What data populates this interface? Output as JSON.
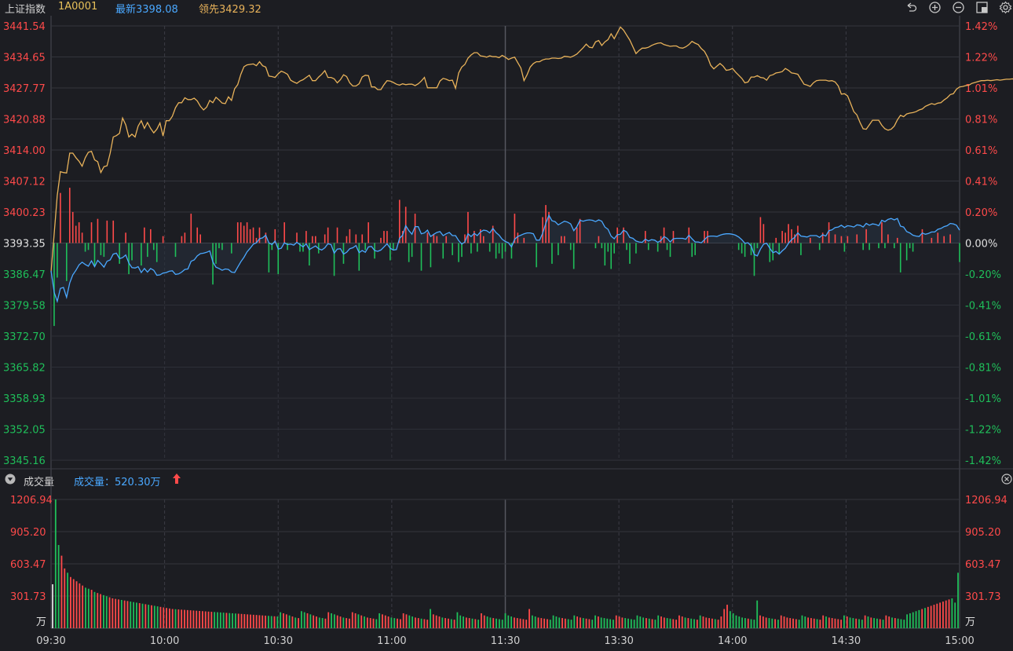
{
  "header": {
    "index_name": "上证指数",
    "index_code": "1A0001",
    "latest_label": "最新3398.08",
    "leading_label": "领先3429.32"
  },
  "toolbar": {
    "icons": [
      "undo-icon",
      "zoom-in-icon",
      "zoom-out-icon",
      "layout-icon",
      "settings-icon"
    ]
  },
  "colors": {
    "background": "#1c1d22",
    "up": "#ff4a4a",
    "down": "#1fbf5a",
    "price_line": "#4aa8ff",
    "leading_line": "#e8b25a",
    "grid": "#33353c"
  },
  "volume_panel": {
    "title": "成交量",
    "volume_label": "成交量：520.30万",
    "unit": "万"
  },
  "chart_data": [
    {
      "type": "line",
      "title": "",
      "x_ticks": [
        "09:30",
        "10:00",
        "10:30",
        "11:00",
        "11:30",
        "13:30",
        "14:00",
        "14:30",
        "15:00"
      ],
      "y_left_ticks": [
        "3441.54",
        "3434.65",
        "3427.77",
        "3420.88",
        "3414.00",
        "3407.12",
        "3400.23",
        "3393.35",
        "3386.47",
        "3379.58",
        "3372.70",
        "3365.82",
        "3358.93",
        "3352.05",
        "3345.16"
      ],
      "y_right_ticks": [
        "1.42%",
        "1.22%",
        "1.01%",
        "0.81%",
        "0.61%",
        "0.41%",
        "0.20%",
        "0.00%",
        "-0.20%",
        "-0.41%",
        "-0.61%",
        "-0.81%",
        "-1.01%",
        "-1.22%",
        "-1.42%"
      ],
      "ylim": [
        3345.16,
        3441.54
      ],
      "prev_close": 3393.35,
      "grid": true,
      "series": [
        {
          "name": "最新",
          "values": [
            3387.2,
            3382.4,
            3380.4,
            3383.3,
            3383.5,
            3381.3,
            3384.5,
            3386.3,
            3387.3,
            3388.5,
            3389.1,
            3388.6,
            3388.2,
            3389.4,
            3388.1,
            3389.5,
            3388.8,
            3388.0,
            3389.3,
            3389.6,
            3390.9,
            3391.1,
            3389.9,
            3390.1,
            3390.7,
            3388.9,
            3387.9,
            3387.8,
            3388.1,
            3386.8,
            3387.7,
            3386.9,
            3387.7,
            3387.3,
            3386.2,
            3386.3,
            3386.7,
            3386.8,
            3387.1,
            3387.2,
            3386.4,
            3386.5,
            3386.9,
            3387.5,
            3387.6,
            3389.3,
            3389.6,
            3390.5,
            3391.0,
            3391.1,
            3391.3,
            3391.6,
            3389.2,
            3388.0,
            3387.7,
            3387.3,
            3387.6,
            3387.5,
            3386.9,
            3386.8,
            3388.0,
            3389.2,
            3390.2,
            3391.4,
            3392.2,
            3393.1,
            3393.4,
            3394.3,
            3394.5,
            3395.1,
            3393.4,
            3393.0,
            3393.8,
            3392.0,
            3392.2,
            3393.4,
            3393.0,
            3393.1,
            3392.9,
            3393.5,
            3393.0,
            3392.5,
            3393.2,
            3391.9,
            3392.3,
            3392.7,
            3392.1,
            3391.8,
            3392.3,
            3393.2,
            3393.0,
            3391.1,
            3392.0,
            3392.1,
            3390.9,
            3391.3,
            3392.1,
            3392.3,
            3392.8,
            3391.2,
            3391.7,
            3391.3,
            3392.5,
            3392.6,
            3391.7,
            3391.5,
            3391.8,
            3392.5,
            3393.2,
            3392.2,
            3391.8,
            3391.9,
            3394.4,
            3395.1,
            3397.2,
            3396.1,
            3395.3,
            3397.0,
            3397.0,
            3395.4,
            3395.6,
            3396.2,
            3394.8,
            3395.3,
            3395.7,
            3395.9,
            3395.0,
            3395.4,
            3395.7,
            3395.0,
            3395.0,
            3393.9,
            3393.1,
            3393.6,
            3395.4,
            3394.8,
            3395.5,
            3395.0,
            3395.8,
            3396.2,
            3396.1,
            3395.6,
            3396.6,
            3395.7,
            3395.1,
            3394.2,
            3393.7,
            3393.4,
            3392.5,
            3394.2,
            3394.8,
            3395.1,
            3395.4,
            3395.6,
            3395.6,
            3395.4,
            3394.0,
            3394.0,
            3395.5,
            3397.7,
            3399.5,
            3398.3,
            3398.1,
            3397.4,
            3397.8,
            3398.2,
            3398.0,
            3397.6,
            3396.1,
            3397.0,
            3398.4,
            3398.2,
            3398.4,
            3398.5,
            3398.4,
            3398.1,
            3398.5,
            3398.2,
            3396.9,
            3396.4,
            3394.9,
            3394.3,
            3395.2,
            3395.3,
            3396.2,
            3395.8,
            3394.6,
            3394.4,
            3393.8,
            3393.6,
            3393.5,
            3394.2,
            3393.8,
            3394.1,
            3394.0,
            3393.5,
            3393.9,
            3394.8,
            3394.4,
            3393.6,
            3394.3,
            3394.4,
            3394.4,
            3394.4,
            3394.2,
            3395.1,
            3394.3,
            3393.6,
            3393.6,
            3393.4,
            3394.1,
            3394.8,
            3394.9,
            3394.9,
            3394.8,
            3395.1,
            3395.3,
            3395.4,
            3395.4,
            3395.3,
            3395.1,
            3394.7,
            3394.1,
            3393.3,
            3393.4,
            3392.7,
            3390.8,
            3390.5,
            3392.0,
            3393.1,
            3393.3,
            3392.2,
            3391.2,
            3391.5,
            3390.9,
            3391.6,
            3392.2,
            3393.3,
            3394.1,
            3394.6,
            3395.6,
            3394.9,
            3394.8,
            3394.7,
            3395.0,
            3395.0,
            3395.0,
            3394.6,
            3395.2,
            3394.9,
            3396.1,
            3396.3,
            3396.8,
            3396.9,
            3397.3,
            3396.8,
            3397.2,
            3397.1,
            3396.9,
            3397.4,
            3397.3,
            3396.9,
            3397.7,
            3397.3,
            3397.6,
            3397.5,
            3397.2,
            3398.4,
            3398.1,
            3398.6,
            3398.8,
            3398.5,
            3398.8,
            3397.1,
            3396.9,
            3395.9,
            3395.6,
            3395.1,
            3394.9,
            3394.8,
            3395.6,
            3395.3,
            3395.5,
            3395.8,
            3395.8,
            3396.4,
            3396.6,
            3397.0,
            3397.2,
            3397.7,
            3397.6,
            3397.3,
            3396.2
          ]
        },
        {
          "name": "领先",
          "values": [
            3386.9,
            3395.4,
            3403.9,
            3409.2,
            3409.0,
            3408.9,
            3413.3,
            3413.3,
            3412.3,
            3411.5,
            3410.4,
            3412.3,
            3413.5,
            3413.7,
            3411.8,
            3411.4,
            3409.0,
            3410.3,
            3410.5,
            3413.3,
            3416.9,
            3417.2,
            3417.7,
            3421.1,
            3419.6,
            3416.9,
            3417.5,
            3416.9,
            3419.3,
            3420.5,
            3418.8,
            3420.1,
            3418.8,
            3417.8,
            3418.6,
            3420.0,
            3417.1,
            3420.5,
            3420.5,
            3421.5,
            3423.4,
            3424.5,
            3424.5,
            3425.6,
            3425.2,
            3425.2,
            3425.5,
            3424.9,
            3423.7,
            3422.9,
            3423.5,
            3425.0,
            3424.5,
            3425.7,
            3425.1,
            3424.4,
            3424.3,
            3425.8,
            3425.0,
            3427.6,
            3428.5,
            3430.8,
            3432.5,
            3432.9,
            3433.0,
            3433.1,
            3432.7,
            3433.6,
            3432.7,
            3432.4,
            3430.4,
            3430.3,
            3430.1,
            3430.9,
            3431.5,
            3431.2,
            3430.8,
            3429.5,
            3429.1,
            3428.8,
            3429.3,
            3429.6,
            3430.1,
            3430.6,
            3429.4,
            3429.4,
            3430.2,
            3430.8,
            3431.6,
            3430.1,
            3430.1,
            3429.8,
            3428.9,
            3429.6,
            3430.7,
            3430.3,
            3428.9,
            3428.2,
            3428.2,
            3428.7,
            3430.2,
            3430.6,
            3430.5,
            3428.0,
            3428.0,
            3427.4,
            3427.4,
            3428.5,
            3429.4,
            3429.3,
            3429.0,
            3428.6,
            3428.4,
            3428.7,
            3428.5,
            3428.6,
            3428.6,
            3428.3,
            3428.7,
            3429.3,
            3430.1,
            3427.8,
            3427.8,
            3427.8,
            3427.8,
            3429.3,
            3429.9,
            3429.7,
            3429.4,
            3429.5,
            3427.7,
            3431.1,
            3432.4,
            3433.0,
            3434.4,
            3435.1,
            3435.6,
            3435.6,
            3434.9,
            3434.8,
            3434.6,
            3434.9,
            3434.7,
            3434.7,
            3434.5,
            3435.0,
            3434.6,
            3434.1,
            3434.4,
            3434.6,
            3433.4,
            3432.2,
            3429.4,
            3430.7,
            3432.4,
            3433.2,
            3433.6,
            3433.6,
            3434.0,
            3434.2,
            3434.2,
            3434.4,
            3434.4,
            3434.3,
            3434.4,
            3434.8,
            3434.7,
            3434.6,
            3434.9,
            3435.3,
            3436.0,
            3436.7,
            3437.5,
            3436.8,
            3436.7,
            3438.0,
            3438.3,
            3437.2,
            3438.0,
            3438.5,
            3439.8,
            3438.7,
            3440.0,
            3441.3,
            3440.6,
            3439.5,
            3438.4,
            3436.9,
            3435.4,
            3436.1,
            3436.6,
            3436.6,
            3436.8,
            3437.2,
            3437.5,
            3437.7,
            3437.8,
            3437.4,
            3437.2,
            3437.0,
            3437.1,
            3437.1,
            3436.7,
            3436.6,
            3436.9,
            3437.4,
            3438.1,
            3437.7,
            3437.4,
            3436.5,
            3435.9,
            3434.6,
            3432.8,
            3432.0,
            3432.6,
            3433.2,
            3432.6,
            3431.7,
            3431.8,
            3432.1,
            3431.3,
            3430.6,
            3429.9,
            3428.9,
            3429.1,
            3430.2,
            3430.2,
            3430.5,
            3430.1,
            3430.0,
            3429.5,
            3430.5,
            3430.7,
            3431.1,
            3431.2,
            3431.4,
            3432.1,
            3431.7,
            3431.1,
            3431.0,
            3430.8,
            3429.7,
            3428.6,
            3428.4,
            3428.1,
            3428.9,
            3429.4,
            3429.5,
            3429.5,
            3429.5,
            3429.3,
            3429.4,
            3429.1,
            3428.2,
            3426.4,
            3426.5,
            3426.0,
            3424.3,
            3422.5,
            3421.8,
            3420.1,
            3418.7,
            3418.6,
            3419.6,
            3420.6,
            3420.6,
            3420.6,
            3419.5,
            3418.7,
            3418.4,
            3418.6,
            3419.3,
            3420.7,
            3421.7,
            3421.4,
            3422.0,
            3422.2,
            3422.3,
            3422.5,
            3422.9,
            3423.1,
            3423.7,
            3424.0,
            3424.3,
            3424.1,
            3424.4,
            3424.5,
            3425.1,
            3425.6,
            3426.3,
            3426.5,
            3427.5,
            3428.0,
            3428.1,
            3428.3,
            3428.4,
            3428.8,
            3429.0,
            3429.2,
            3429.4,
            3429.4,
            3429.5,
            3429.4,
            3429.5,
            3429.6,
            3429.5,
            3429.6,
            3429.7,
            3429.7,
            3429.8,
            3429.5,
            3429.6,
            3429.8,
            3430.0,
            3430.2,
            3430.1,
            3430.4,
            3430.7,
            3431.0,
            3431.2,
            3430.9,
            3429.7,
            3429.6,
            3429.4,
            3429.3
          ]
        }
      ]
    },
    {
      "type": "bar",
      "title": "成交量",
      "x_ticks": [
        "09:30",
        "10:00",
        "10:30",
        "11:00",
        "11:30",
        "13:30",
        "14:00",
        "14:30",
        "15:00"
      ],
      "y_ticks": [
        "1206.94",
        "905.20",
        "603.47",
        "301.73"
      ],
      "y_unit": "万",
      "ylim": [
        0,
        1206.94
      ],
      "values": [
        412,
        1207,
        780,
        680,
        560,
        520,
        480,
        460,
        440,
        420,
        400,
        380,
        370,
        360,
        340,
        330,
        320,
        310,
        300,
        290,
        280,
        275,
        270,
        265,
        260,
        255,
        250,
        245,
        240,
        235,
        230,
        225,
        220,
        215,
        210,
        205,
        200,
        195,
        190,
        185,
        180,
        178,
        176,
        174,
        172,
        170,
        168,
        166,
        164,
        162,
        160,
        158,
        156,
        154,
        152,
        150,
        148,
        146,
        144,
        142,
        140,
        138,
        136,
        134,
        132,
        130,
        128,
        126,
        124,
        122,
        120,
        118,
        116,
        114,
        112,
        110,
        150,
        140,
        130,
        120,
        110,
        100,
        95,
        160,
        150,
        140,
        130,
        120,
        110,
        100,
        95,
        90,
        150,
        140,
        130,
        120,
        110,
        100,
        95,
        90,
        150,
        140,
        130,
        120,
        110,
        100,
        95,
        90,
        85,
        140,
        130,
        120,
        110,
        100,
        95,
        90,
        85,
        140,
        130,
        120,
        110,
        100,
        95,
        90,
        85,
        80,
        180,
        130,
        120,
        110,
        100,
        95,
        90,
        85,
        80,
        150,
        120,
        110,
        100,
        95,
        90,
        85,
        80,
        140,
        120,
        110,
        100,
        95,
        90,
        85,
        80,
        140,
        120,
        110,
        100,
        95,
        90,
        85,
        80,
        180,
        120,
        110,
        100,
        95,
        90,
        85,
        80,
        120,
        110,
        100,
        95,
        90,
        85,
        80,
        120,
        110,
        100,
        95,
        90,
        85,
        80,
        120,
        110,
        100,
        95,
        90,
        85,
        80,
        120,
        110,
        100,
        95,
        90,
        85,
        80,
        120,
        110,
        100,
        95,
        90,
        85,
        80,
        120,
        110,
        100,
        95,
        90,
        85,
        80,
        120,
        110,
        100,
        95,
        90,
        85,
        80,
        120,
        110,
        100,
        95,
        90,
        85,
        80,
        110,
        180,
        220,
        160,
        140,
        120,
        110,
        100,
        95,
        90,
        85,
        80,
        260,
        120,
        110,
        100,
        95,
        90,
        85,
        80,
        120,
        110,
        100,
        95,
        90,
        85,
        80,
        120,
        110,
        100,
        95,
        90,
        85,
        80,
        120,
        110,
        100,
        95,
        90,
        85,
        80,
        120,
        110,
        100,
        95,
        90,
        85,
        80,
        120,
        110,
        100,
        95,
        90,
        85,
        80,
        120,
        110,
        100,
        95,
        90,
        85,
        80,
        130,
        140,
        150,
        160,
        170,
        180,
        190,
        200,
        210,
        220,
        230,
        240,
        250,
        260,
        270,
        280,
        240,
        520
      ],
      "colors_rule": "red when price up from prior minute, green when down"
    }
  ]
}
